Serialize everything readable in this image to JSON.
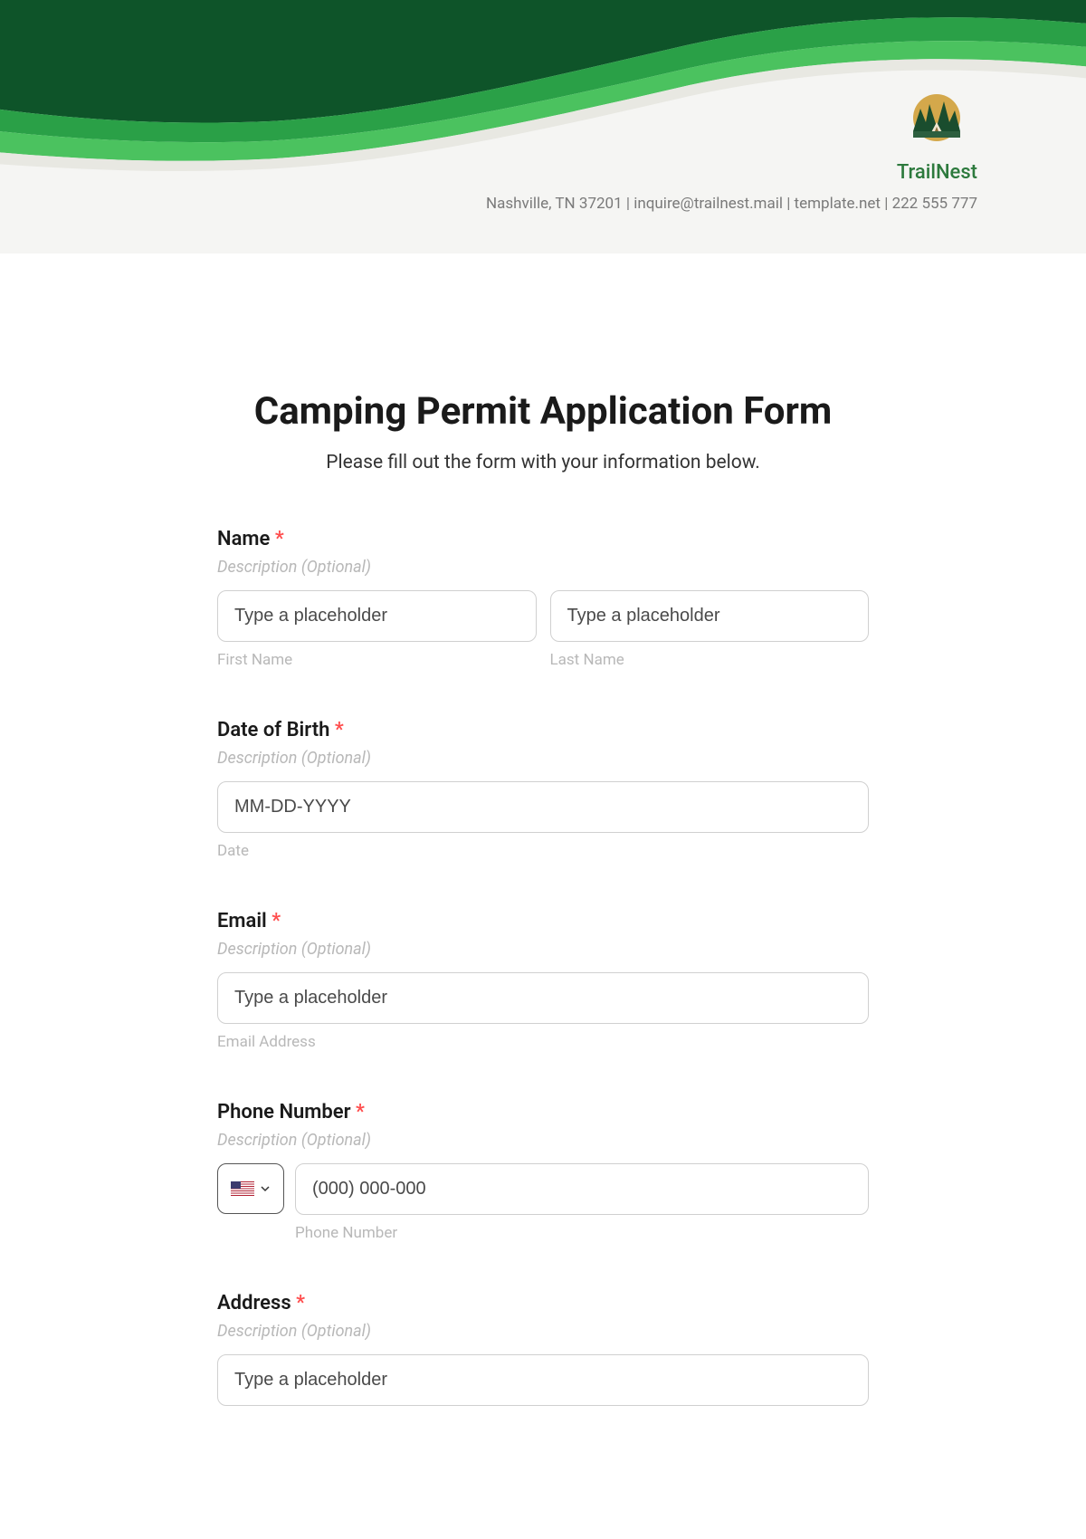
{
  "header": {
    "brand_name": "TrailNest",
    "contact_info": "Nashville, TN 37201 | inquire@trailnest.mail | template.net | 222 555 777"
  },
  "form": {
    "title": "Camping Permit Application Form",
    "subtitle": "Please fill out the form with your information below.",
    "fields": {
      "name": {
        "label": "Name",
        "description": "Description (Optional)",
        "first_placeholder": "Type a placeholder",
        "last_placeholder": "Type a placeholder",
        "first_sublabel": "First Name",
        "last_sublabel": "Last Name"
      },
      "dob": {
        "label": "Date of Birth",
        "description": "Description (Optional)",
        "placeholder": "MM-DD-YYYY",
        "sublabel": "Date"
      },
      "email": {
        "label": "Email",
        "description": "Description (Optional)",
        "placeholder": "Type a placeholder",
        "sublabel": "Email Address"
      },
      "phone": {
        "label": "Phone Number",
        "description": "Description (Optional)",
        "placeholder": "(000) 000-000",
        "sublabel": "Phone Number"
      },
      "address": {
        "label": "Address",
        "description": "Description (Optional)",
        "placeholder": "Type a placeholder"
      }
    },
    "required_marker": "*"
  }
}
